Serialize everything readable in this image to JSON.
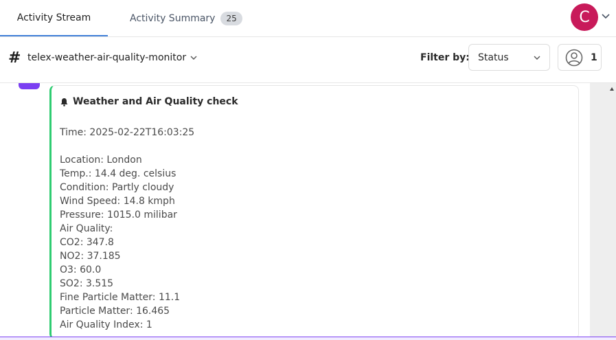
{
  "tabs": [
    {
      "label": "Activity Stream"
    },
    {
      "label": "Activity Summary",
      "badge": "25"
    }
  ],
  "user": {
    "avatar_initial": "C",
    "avatar_color": "#c81a5a"
  },
  "channel": {
    "name": "telex-weather-air-quality-monitor"
  },
  "filter": {
    "label": "Filter by:",
    "selected": "Status"
  },
  "members": {
    "count": "1"
  },
  "message": {
    "title": "Weather and Air Quality check",
    "lines": [
      "Time: 2025-02-22T16:03:25",
      "Location: London",
      "Temp.: 14.4 deg. celsius",
      "Condition: Partly cloudy",
      "Wind Speed: 14.8 kmph",
      "Pressure: 1015.0 milibar",
      "Air Quality:",
      "CO2: 347.8",
      "NO2: 37.185",
      "O3: 60.0",
      "SO2: 3.515",
      "Fine Particle Matter: 11.1",
      "Particle Matter: 16.465",
      "Air Quality Index: 1"
    ]
  },
  "colors": {
    "accent": "#3f7fd8",
    "card_border": "#2ecc71",
    "marker": "#7b3ff2"
  }
}
